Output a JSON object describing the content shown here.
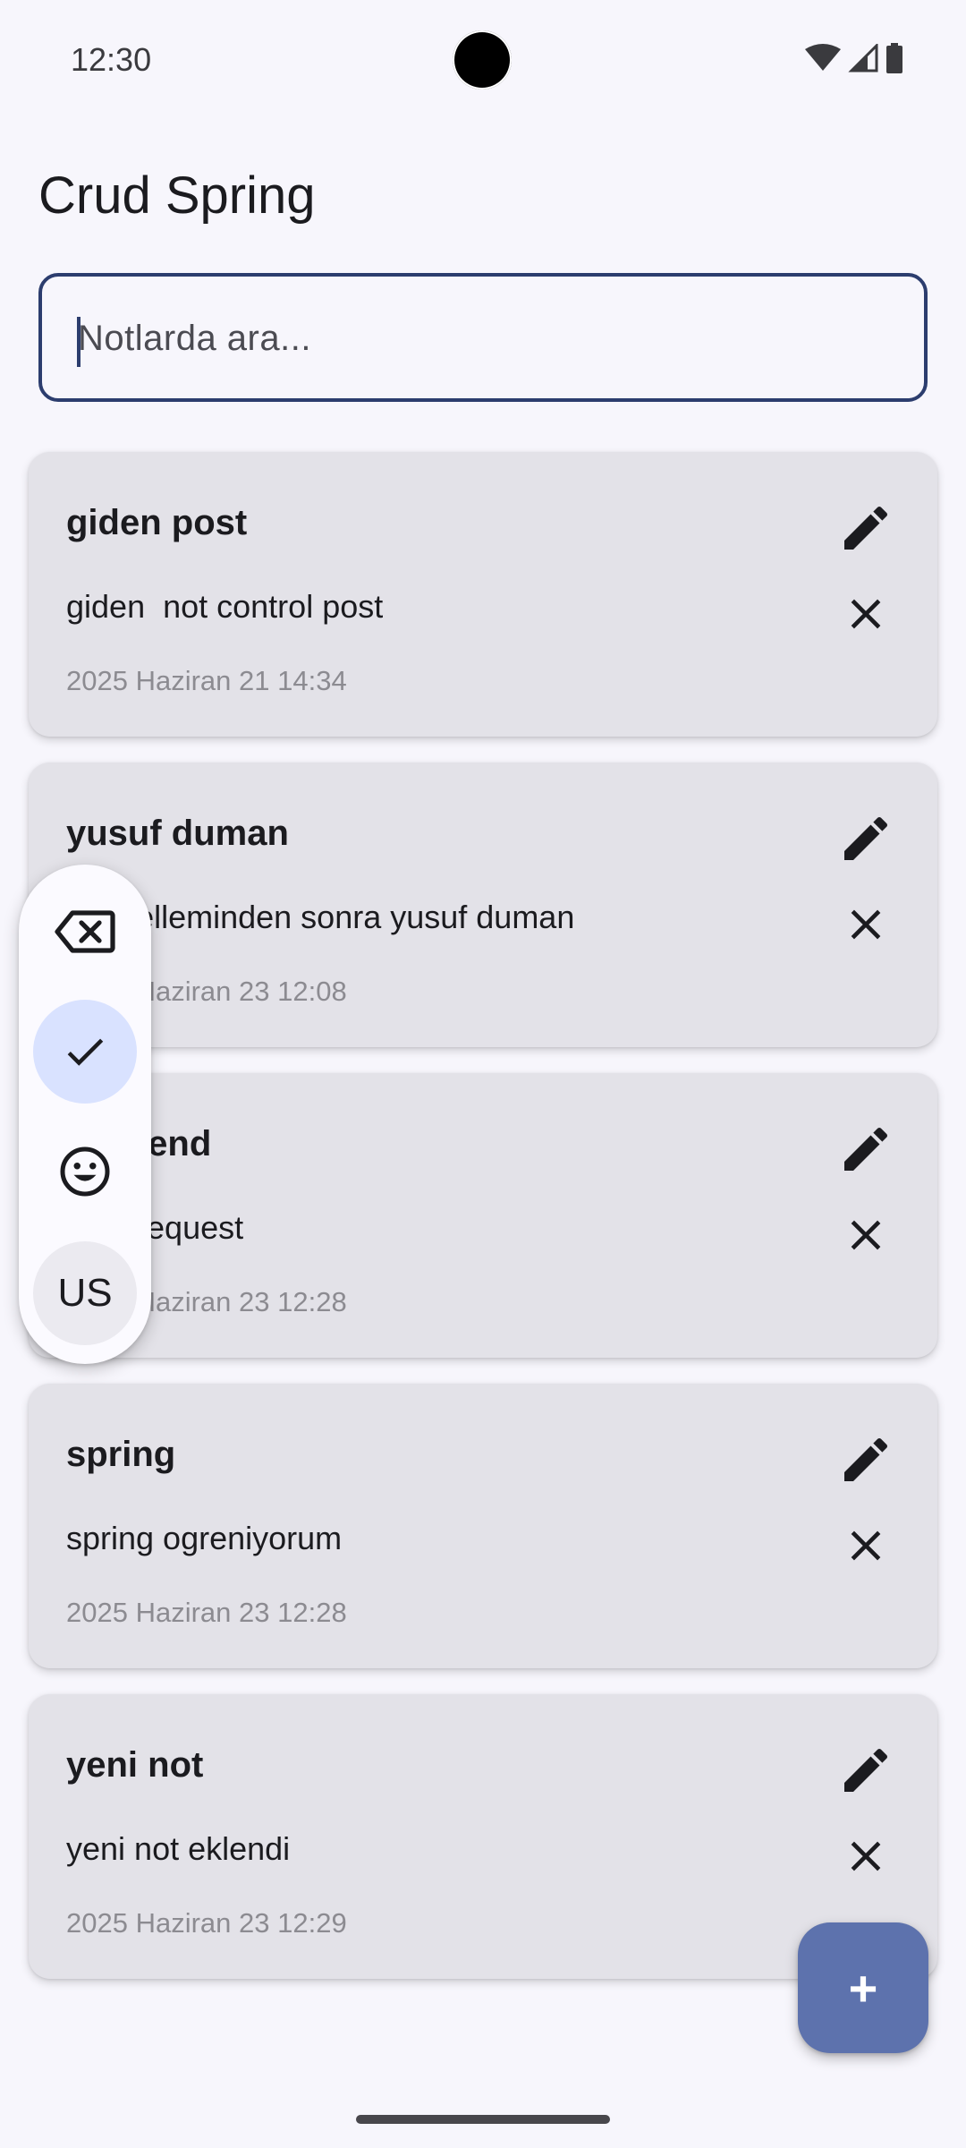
{
  "status_bar": {
    "time": "12:30"
  },
  "app": {
    "title": "Crud Spring"
  },
  "search": {
    "placeholder": "Notlarda ara...",
    "value": ""
  },
  "notes": [
    {
      "title": "giden post",
      "content": "giden  not control post",
      "date": "2025 Haziran 21 14:34"
    },
    {
      "title": "yusuf duman",
      "content": "güncelleminden sonra yusuf duman",
      "date": "2025 Haziran 23 12:08"
    },
    {
      "title": "backend",
      "content": "post request",
      "date": "2025 Haziran 23 12:28"
    },
    {
      "title": "spring",
      "content": "spring ogreniyorum",
      "date": "2025 Haziran 23 12:28"
    },
    {
      "title": "yeni not",
      "content": "yeni not eklendi",
      "date": "2025 Haziran 23 12:29"
    }
  ],
  "keyboard_toolbar": {
    "language_label": "US"
  },
  "fab": {
    "label": "+"
  },
  "icons": {
    "edit": "pencil-icon",
    "delete": "close-icon",
    "backspace": "backspace-icon",
    "check": "check-icon",
    "emoji": "emoji-icon"
  },
  "colors": {
    "accent": "#2c3d6e",
    "fab": "#5d72ad",
    "card": "#e3e2e8",
    "selected": "#d9e2ff"
  }
}
